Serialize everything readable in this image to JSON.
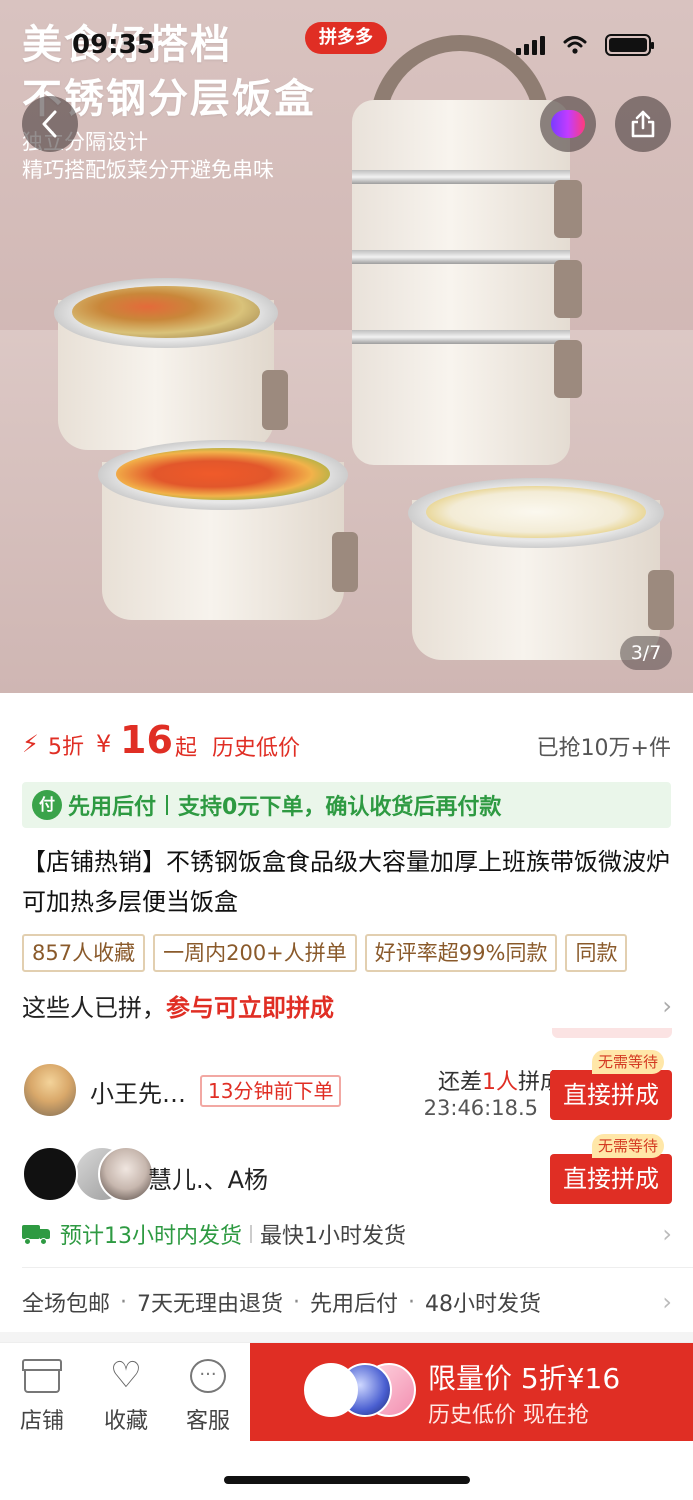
{
  "status_bar": {
    "time": "09:35",
    "app_badge": "拼多多"
  },
  "hero": {
    "title_line1": "美食好搭档",
    "title_line2": "不锈钢分层饭盒",
    "sub_line1": "独立分隔设计",
    "sub_line2": "精巧搭配饭菜分开避免串味",
    "image_counter": "3/7"
  },
  "price": {
    "discount": "5折",
    "currency": "¥",
    "amount": "16",
    "suffix": "起",
    "tag": "历史低价",
    "sold": "已抢10万+件"
  },
  "paylater": {
    "badge": "付",
    "label": "先用后付",
    "detail": "支持0元下单，确认收货后再付款"
  },
  "product": {
    "title": "【店铺热销】不锈钢饭盒食品级大容量加厚上班族带饭微波炉可加热多层便当饭盒"
  },
  "tags": [
    "857人收藏",
    "一周内200+人拼单",
    "好评率超99%同款",
    "同款"
  ],
  "group": {
    "head_text": "这些人已拼，",
    "head_highlight": "参与可立即拼成",
    "rows": [
      {
        "name": "小王先…",
        "time_tag": "13分钟前下单",
        "need_prefix": "还差",
        "need_count": "1人",
        "need_suffix": "拼成",
        "countdown": "23:46:18.5",
        "button": "直接拼成",
        "badge": "无需等待"
      },
      {
        "name": "慧儿.、A杨",
        "button": "直接拼成",
        "badge": "无需等待"
      }
    ]
  },
  "shipping": {
    "estimate": "预计13小时内发货",
    "fastest": "最快1小时发货"
  },
  "services": [
    "全场包邮",
    "7天无理由退货",
    "先用后付",
    "48小时发货"
  ],
  "bottom_nav": {
    "store": "店铺",
    "favorite": "收藏",
    "service": "客服"
  },
  "buy_button": {
    "line1": "限量价 5折¥16",
    "line2": "历史低价 现在抢"
  },
  "colors": {
    "brand_red": "#e02e24",
    "pay_green": "#2e9a42",
    "tag_border": "#e2cfb0"
  }
}
